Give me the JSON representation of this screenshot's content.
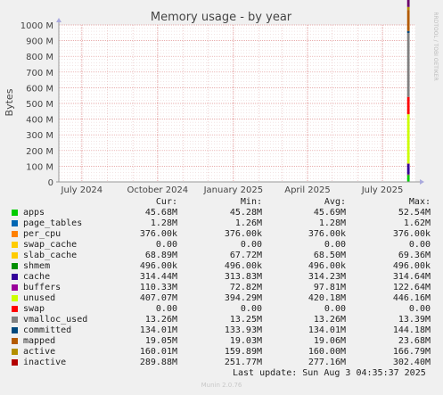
{
  "chart_data": {
    "type": "area",
    "title": "Memory usage - by year",
    "ylabel": "Bytes",
    "watermark": "RRDTOOL / TOBI OETIKER",
    "ylim": [
      0,
      1000000000
    ],
    "y_ticks": [
      {
        "value": 0,
        "label": "0"
      },
      {
        "value": 100000000,
        "label": "100 M"
      },
      {
        "value": 200000000,
        "label": "200 M"
      },
      {
        "value": 300000000,
        "label": "300 M"
      },
      {
        "value": 400000000,
        "label": "400 M"
      },
      {
        "value": 500000000,
        "label": "500 M"
      },
      {
        "value": 600000000,
        "label": "600 M"
      },
      {
        "value": 700000000,
        "label": "700 M"
      },
      {
        "value": 800000000,
        "label": "800 M"
      },
      {
        "value": 900000000,
        "label": "900 M"
      },
      {
        "value": 1000000000,
        "label": "1000 M"
      }
    ],
    "x_range": [
      "2024-06-03",
      "2025-08-10"
    ],
    "x_ticks": [
      {
        "date": "2024-07-01",
        "label": "July 2024"
      },
      {
        "date": "2024-10-01",
        "label": "October 2024"
      },
      {
        "date": "2025-01-01",
        "label": "January 2025"
      },
      {
        "date": "2025-04-01",
        "label": "April 2025"
      },
      {
        "date": "2025-07-01",
        "label": "July 2025"
      }
    ],
    "data_start": "2025-07-31",
    "data_end": "2025-08-03",
    "grid": true,
    "legend_placement": "bottom",
    "columns": [
      "Cur:",
      "Min:",
      "Avg:",
      "Max:"
    ],
    "series": [
      {
        "name": "apps",
        "color": "#00cc00",
        "cur": "45.68M",
        "min": "45.28M",
        "avg": "45.69M",
        "max": "52.54M",
        "value": 45680000
      },
      {
        "name": "page_tables",
        "color": "#0066b3",
        "cur": "1.28M",
        "min": "1.26M",
        "avg": "1.28M",
        "max": "1.62M",
        "value": 1280000
      },
      {
        "name": "per_cpu",
        "color": "#ff8000",
        "cur": "376.00k",
        "min": "376.00k",
        "avg": "376.00k",
        "max": "376.00k",
        "value": 376000
      },
      {
        "name": "swap_cache",
        "color": "#ffcc00",
        "cur": "0.00",
        "min": "0.00",
        "avg": "0.00",
        "max": "0.00",
        "value": 0
      },
      {
        "name": "slab_cache",
        "color": "#330099",
        "cur": "68.89M",
        "min": "67.72M",
        "avg": "68.50M",
        "max": "69.36M",
        "value": 68890000
      },
      {
        "name": "shmem",
        "color": "#990099",
        "cur": "496.00k",
        "min": "496.00k",
        "avg": "496.00k",
        "max": "496.00k",
        "value": 496000
      },
      {
        "name": "cache",
        "color": "#ccff00",
        "cur": "314.44M",
        "min": "313.83M",
        "avg": "314.23M",
        "max": "314.64M",
        "value": 314440000
      },
      {
        "name": "buffers",
        "color": "#ff0000",
        "cur": "110.33M",
        "min": "72.82M",
        "avg": "97.81M",
        "max": "122.64M",
        "value": 110330000
      },
      {
        "name": "unused",
        "color": "#808080",
        "cur": "407.07M",
        "min": "394.29M",
        "avg": "420.18M",
        "max": "446.16M",
        "value": 407070000
      },
      {
        "name": "swap",
        "color": "#008f00",
        "cur": "0.00",
        "min": "0.00",
        "avg": "0.00",
        "max": "0.00",
        "value": 0
      },
      {
        "name": "vmalloc_used",
        "color": "#00487d",
        "cur": "13.26M",
        "min": "13.25M",
        "avg": "13.26M",
        "max": "13.39M",
        "value": 13260000
      },
      {
        "name": "committed",
        "color": "#b35a00",
        "cur": "134.01M",
        "min": "133.93M",
        "avg": "134.01M",
        "max": "144.18M",
        "value": 134010000
      },
      {
        "name": "mapped",
        "color": "#b38f00",
        "cur": "19.05M",
        "min": "19.03M",
        "avg": "19.06M",
        "max": "23.68M",
        "value": 19050000
      },
      {
        "name": "active",
        "color": "#6b006b",
        "cur": "160.01M",
        "min": "159.89M",
        "avg": "160.00M",
        "max": "166.79M",
        "value": 160010000
      },
      {
        "name": "inactive",
        "color": "#8fb300",
        "cur": "289.88M",
        "min": "251.77M",
        "avg": "277.16M",
        "max": "302.40M",
        "value": 289880000
      }
    ],
    "swatch_colors": [
      "#00cc00",
      "#0066b3",
      "#ff8000",
      "#ffcc00",
      "#ffcc00",
      "#008f00",
      "#330099",
      "#990099",
      "#ccff00",
      "#ff0000",
      "#808080",
      "#00487d",
      "#b35a00",
      "#b38f00",
      "#b30000"
    ]
  },
  "footer": {
    "last_update": "Last update: Sun Aug  3 04:35:37 2025",
    "version": "Munin 2.0.76"
  }
}
